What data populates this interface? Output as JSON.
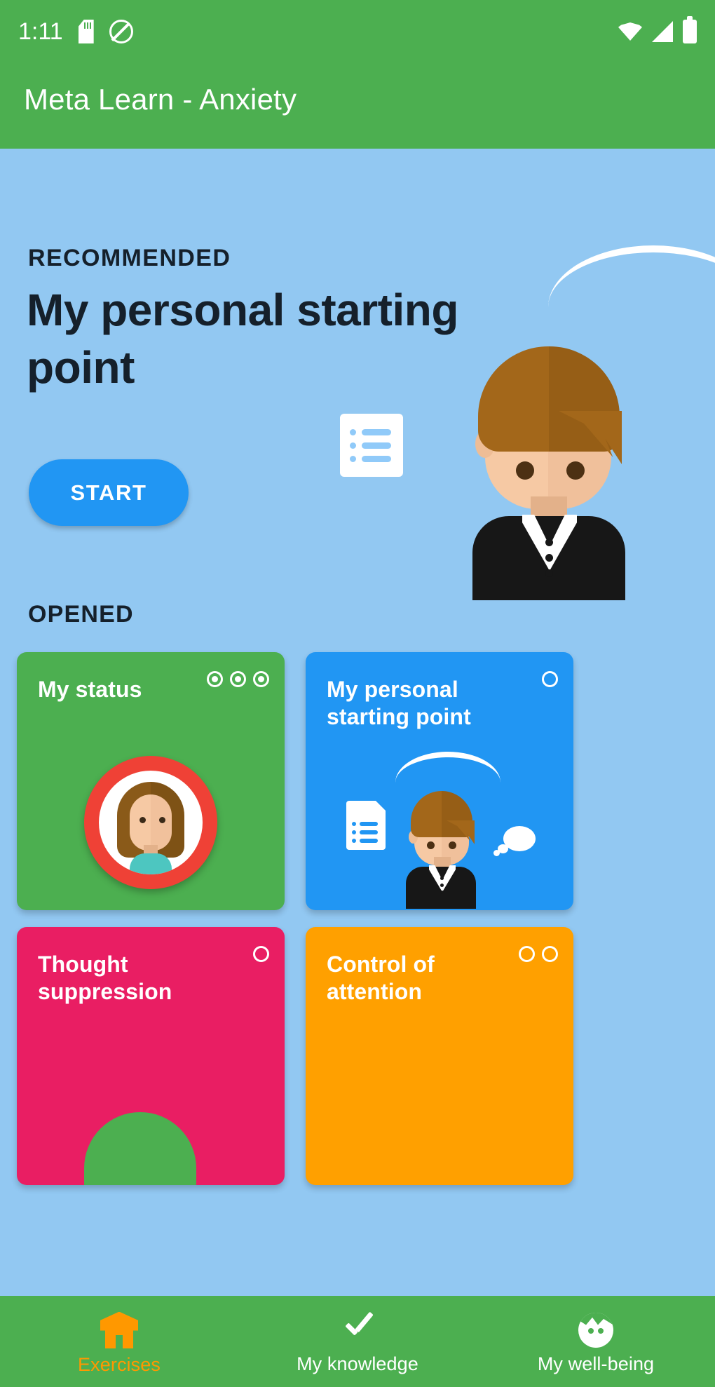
{
  "statusbar": {
    "time": "1:11",
    "icons": [
      "sd-card-icon",
      "mute-icon",
      "wifi-icon",
      "signal-icon",
      "battery-icon"
    ]
  },
  "appbar": {
    "title": "Meta Learn - Anxiety",
    "background": "#4caf50"
  },
  "theme": {
    "page_background": "#92c8f2",
    "accent_blue": "#2196f3",
    "accent_green": "#4caf50",
    "accent_orange": "#ff9800",
    "accent_pink": "#e91e63",
    "accent_amber": "#ffa000",
    "text_dark": "#15202b"
  },
  "hero": {
    "label": "RECOMMENDED",
    "title": "My personal starting point",
    "start_label": "START",
    "illustration": "document-and-person-illustration"
  },
  "opened": {
    "label": "OPENED",
    "cards": [
      {
        "title": "My status",
        "color": "green",
        "dots_total": 3,
        "dots_filled": 3,
        "illustration": "female-avatar-red-ring"
      },
      {
        "title": "My personal starting point",
        "color": "blue",
        "dots_total": 1,
        "dots_filled": 0,
        "illustration": "document-person-thought-bubble"
      },
      {
        "title": "Thought suppression",
        "color": "pink",
        "dots_total": 1,
        "dots_filled": 0,
        "illustration": "green-blob"
      },
      {
        "title": "Control of attention",
        "color": "orange",
        "dots_total": 2,
        "dots_filled": 0,
        "illustration": "none"
      }
    ]
  },
  "bottomnav": {
    "items": [
      {
        "label": "Exercises",
        "icon": "house-icon",
        "active": true
      },
      {
        "label": "My knowledge",
        "icon": "check-icon",
        "active": false
      },
      {
        "label": "My well-being",
        "icon": "face-icon",
        "active": false
      }
    ]
  }
}
